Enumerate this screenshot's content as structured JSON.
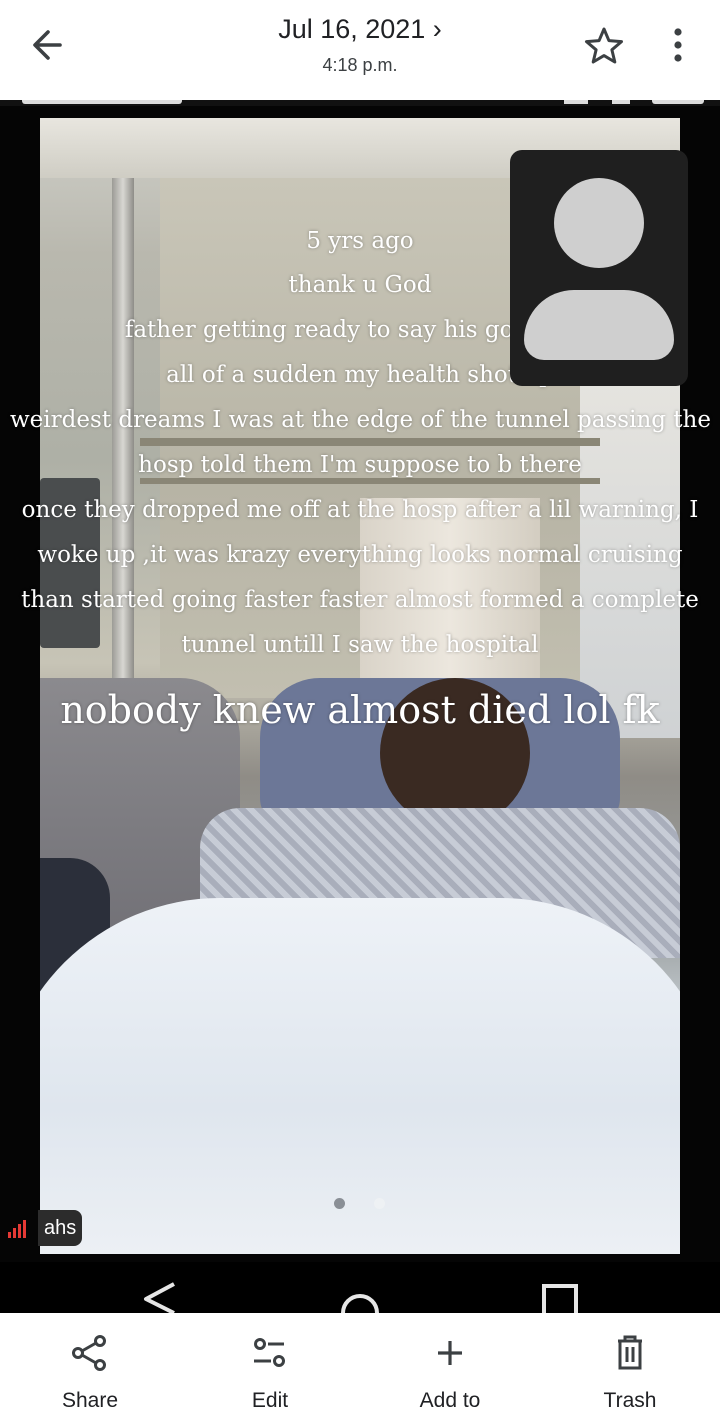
{
  "header": {
    "date": "Jul 16, 2021 ›",
    "time": "4:18 p.m."
  },
  "photo": {
    "overlay_lines": [
      "5 yrs ago",
      "thank u God",
      "father getting ready to say his goodbyes",
      "all of a sudden my health shot up",
      "weirdest dreams I was at the edge of the tunnel passing the",
      "hosp told them I'm suppose to b there",
      "once they dropped me off at the hosp after a lil warning, I",
      "woke up ,it was krazy everything looks normal cruising",
      "than started going faster faster almost formed a complete",
      "tunnel untill I saw the hospital"
    ],
    "caption_big": "nobody knew almost died lol fk",
    "carrier_label": "ahs"
  },
  "actions": [
    {
      "label": "Share",
      "icon": "share-icon"
    },
    {
      "label": "Edit",
      "icon": "edit-sliders-icon"
    },
    {
      "label": "Add to",
      "icon": "plus-icon"
    },
    {
      "label": "Trash",
      "icon": "trash-icon"
    }
  ]
}
